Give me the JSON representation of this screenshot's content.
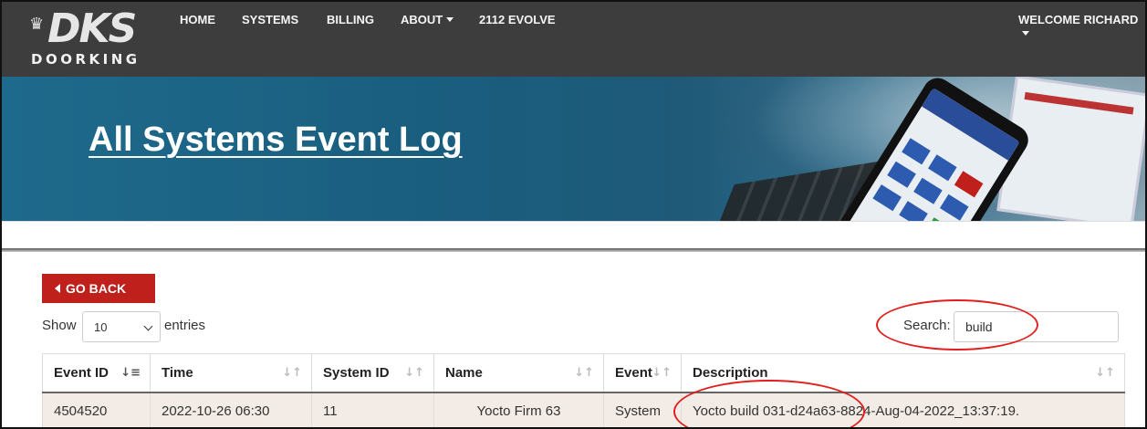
{
  "brand": {
    "mark": "DKS",
    "wordmark": "DOORKING",
    "crown": "♛"
  },
  "nav": {
    "items": [
      {
        "label": "HOME"
      },
      {
        "label": "SYSTEMS"
      },
      {
        "label": "BILLING"
      },
      {
        "label": "ABOUT"
      },
      {
        "label": "2112 EVOLVE"
      }
    ],
    "user_label": "WELCOME RICHARD"
  },
  "hero": {
    "title": "All Systems Event Log"
  },
  "actions": {
    "go_back_label": "GO BACK"
  },
  "length_control": {
    "show_label": "Show",
    "selected": "10",
    "entries_label": "entries"
  },
  "search": {
    "label": "Search:",
    "value": "build"
  },
  "table": {
    "columns": [
      "Event ID",
      "Time",
      "System ID",
      "Name",
      "Event",
      "Description"
    ],
    "rows": [
      [
        "4504520",
        "2022-10-26 06:30",
        "11",
        "Yocto Firm 63",
        "System",
        "Yocto build 031-d24a63-8824-Aug-04-2022_13:37:19."
      ]
    ]
  },
  "colors": {
    "navbar": "#3d3d3d",
    "accent_red": "#c0201b",
    "annotation": "#e21e1e",
    "row_bg": "#f3ece6"
  }
}
